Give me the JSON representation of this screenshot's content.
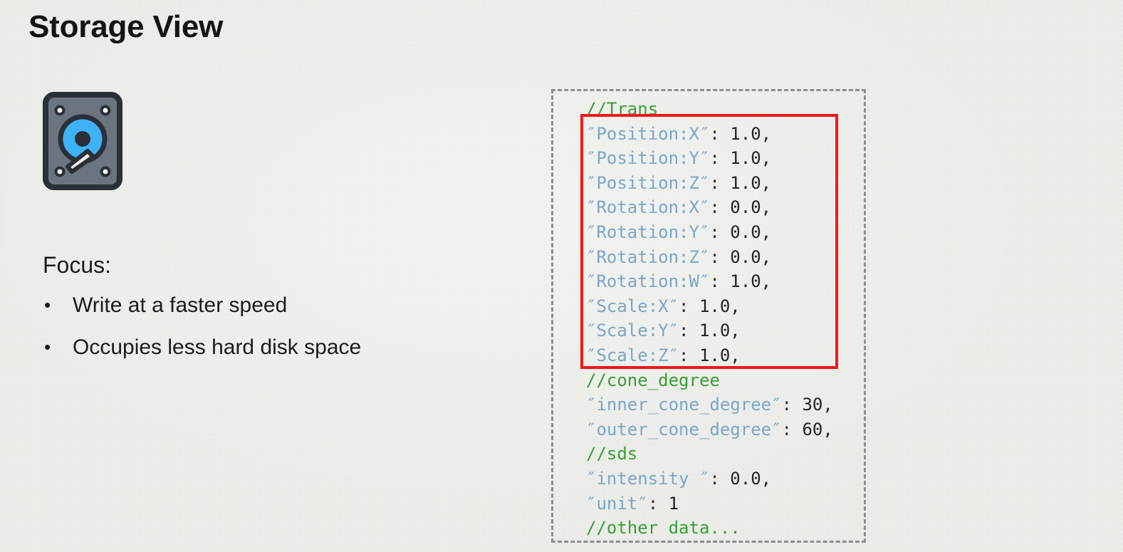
{
  "slide": {
    "title": "Storage View",
    "background_color": "#ebebe7"
  },
  "icon": {
    "name": "hard-disk-icon",
    "body_color": "#6b7580",
    "outline_color": "#2b2f36",
    "platter_color": "#3fb2f7",
    "hub_color": "#2b2f36",
    "arm_color": "#eeeeee",
    "screw_color": "#ffffff"
  },
  "focus": {
    "heading": "Focus:",
    "bullet_glyph": "•",
    "items": [
      "Write at a faster speed",
      "Occupies less hard disk space"
    ]
  },
  "code": {
    "highlight_color": "#ef1a1a",
    "border_color": "#8e8e8e",
    "comment_color": "#37a037",
    "key_color": "#7aa7c9",
    "value_color": "#242424",
    "lines": [
      {
        "type": "comment",
        "text": "//Trans"
      },
      {
        "type": "pair",
        "key": "″Position:X″",
        "sep": ": ",
        "value": "1.0,"
      },
      {
        "type": "pair",
        "key": "″Position:Y″",
        "sep": ": ",
        "value": "1.0,"
      },
      {
        "type": "pair",
        "key": "″Position:Z″",
        "sep": ": ",
        "value": "1.0,"
      },
      {
        "type": "pair",
        "key": "″Rotation:X″",
        "sep": ": ",
        "value": "0.0,"
      },
      {
        "type": "pair",
        "key": "″Rotation:Y″",
        "sep": ": ",
        "value": "0.0,"
      },
      {
        "type": "pair",
        "key": "″Rotation:Z″",
        "sep": ": ",
        "value": "0.0,"
      },
      {
        "type": "pair",
        "key": "″Rotation:W″",
        "sep": ": ",
        "value": "1.0,"
      },
      {
        "type": "pair",
        "key": "″Scale:X″",
        "sep": ": ",
        "value": "1.0,"
      },
      {
        "type": "pair",
        "key": "″Scale:Y″",
        "sep": ": ",
        "value": "1.0,"
      },
      {
        "type": "pair",
        "key": "″Scale:Z″",
        "sep": ": ",
        "value": "1.0,"
      },
      {
        "type": "comment",
        "text": "//cone_degree"
      },
      {
        "type": "pair",
        "key": "″inner_cone_degree″",
        "sep": ": ",
        "value": "30,"
      },
      {
        "type": "pair",
        "key": "″outer_cone_degree″",
        "sep": ": ",
        "value": "60,"
      },
      {
        "type": "comment",
        "text": "//sds"
      },
      {
        "type": "pair",
        "key": "″intensity ″",
        "sep": ": ",
        "value": "0.0,"
      },
      {
        "type": "pair",
        "key": "″unit″",
        "sep": ": ",
        "value": "1"
      },
      {
        "type": "comment",
        "text": "//other data..."
      }
    ],
    "highlight_from_line": 1,
    "highlight_to_line": 10
  }
}
